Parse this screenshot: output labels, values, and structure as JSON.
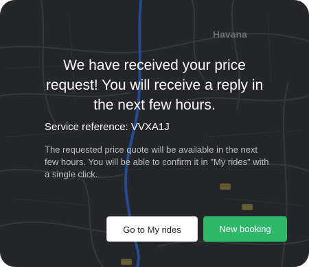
{
  "map": {
    "city_label": "Havana",
    "route_color": "#2a6fd6"
  },
  "dialog": {
    "headline": "We have received your price request! You will receive a reply in the next few hours.",
    "service_reference": "Service reference: VVXA1J",
    "description": "The requested price quote will be available in the next few hours. You will be able to confirm it in \"My rides\" with a single click."
  },
  "buttons": {
    "my_rides_label": "Go to My rides",
    "new_booking_label": "New booking"
  },
  "colors": {
    "primary": "#2fb86a",
    "card_bg": "#2f3033"
  }
}
